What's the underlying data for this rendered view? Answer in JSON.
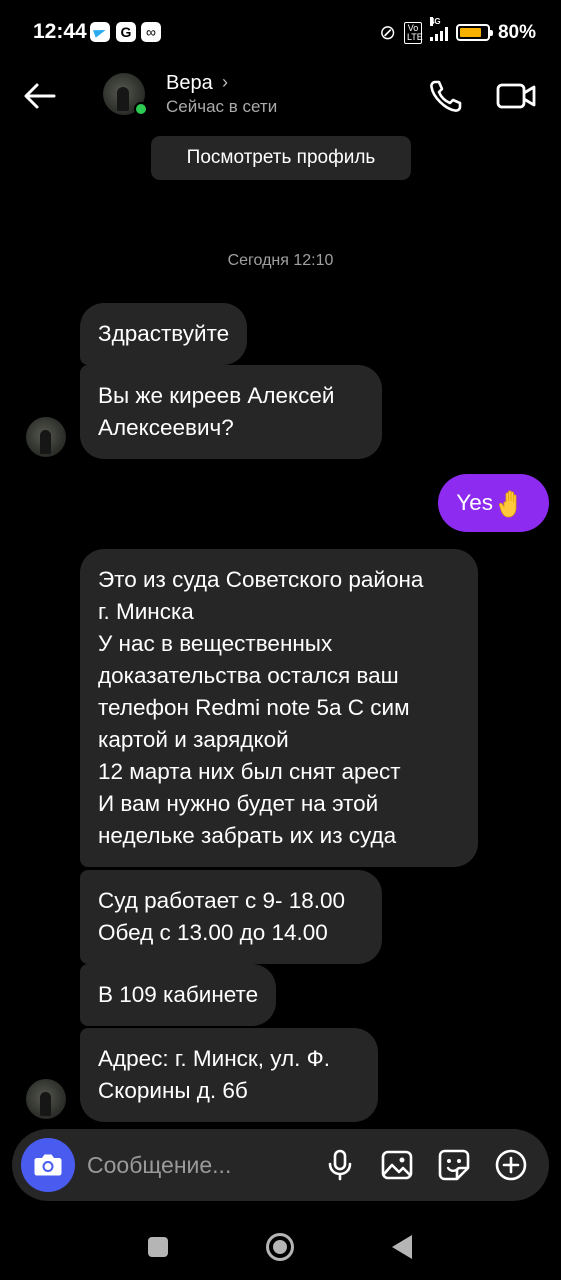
{
  "status_bar": {
    "time": "12:44",
    "battery_percent": "80%",
    "battery_level": 0.8,
    "network": "4G",
    "volte": "Vo LTE",
    "notification_icons": [
      "telegram-icon",
      "google-icon",
      "link-icon"
    ]
  },
  "header": {
    "contact_name": "Вера",
    "chevron": "›",
    "status": "Сейчас в сети",
    "online_color": "#2DCB54"
  },
  "profile_button": "Посмотреть профиль",
  "timestamp": "Сегодня 12:10",
  "messages": [
    {
      "direction": "incoming",
      "text": "Здраствуйте"
    },
    {
      "direction": "incoming",
      "text": "Вы же киреев Алексей Алексеевич?"
    },
    {
      "direction": "outgoing",
      "text": "Yes",
      "emoji": "raised-hand"
    },
    {
      "direction": "incoming",
      "lines": [
        "Это из суда Советского района",
        "г. Минска",
        "У нас в вещественных доказательства остался ваш телефон Redmi note 5a С сим картой и зарядкой",
        "12 марта них был снят арест",
        "И вам нужно будет на этой недельке забрать их из суда"
      ]
    },
    {
      "direction": "incoming",
      "lines": [
        "Суд работает с 9- 18.00",
        "Обед с 13.00 до 14.00"
      ]
    },
    {
      "direction": "incoming",
      "text": "В 109 кабинете"
    },
    {
      "direction": "incoming",
      "text": "Адрес: г. Минск, ул. Ф. Скорины д. 6б"
    }
  ],
  "composer": {
    "placeholder": "Сообщение...",
    "camera_color": "#4A5CF0"
  },
  "colors": {
    "background": "#000000",
    "incoming_bubble": "#262626",
    "outgoing_bubble": "#8E2BF0"
  }
}
